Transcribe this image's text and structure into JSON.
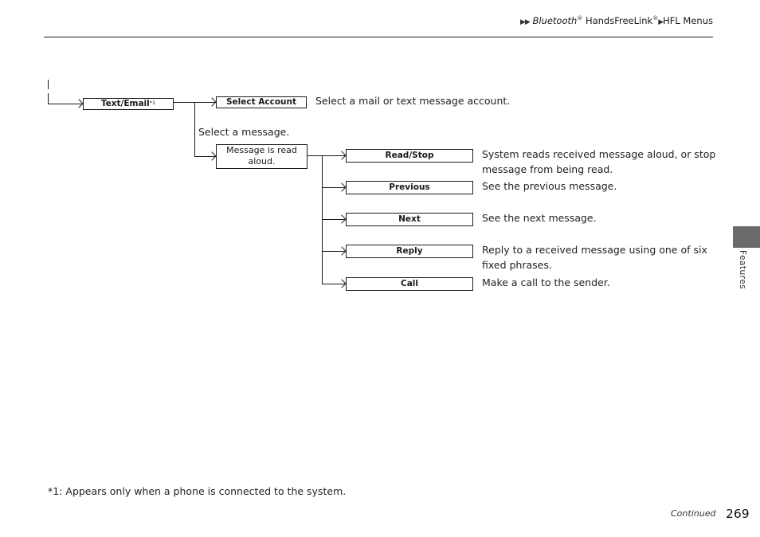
{
  "header": {
    "breadcrumb_marker": "▶▶",
    "breadcrumb_part1": "Bluetooth",
    "breadcrumb_reg1": "®",
    "breadcrumb_part2": " HandsFreeLink",
    "breadcrumb_reg2": "®",
    "breadcrumb_sep": "▶",
    "breadcrumb_part3": "HFL Menus"
  },
  "diagram": {
    "root": {
      "label": "Text/Email",
      "footnote_ref": "*1"
    },
    "level1": [
      {
        "label": "Select Account",
        "description": "Select a mail or text message account."
      },
      {
        "prompt": "Select a message.",
        "label_line1": "Message is read",
        "label_line2": "aloud."
      }
    ],
    "level2": [
      {
        "label": "Read/Stop",
        "description_line1": "System reads received message aloud, or stop",
        "description_line2": "message from being read."
      },
      {
        "label": "Previous",
        "description": "See the previous message."
      },
      {
        "label": "Next",
        "description": "See the next message."
      },
      {
        "label": "Reply",
        "description_line1": "Reply to a received message using one of six",
        "description_line2": "fixed phrases."
      },
      {
        "label": "Call",
        "description": "Make a call to the sender."
      }
    ]
  },
  "side_tab": {
    "label": "Features"
  },
  "footer": {
    "footnote": "*1: Appears only when a phone is connected to the system.",
    "continued": "Continued",
    "page_number": "269"
  }
}
